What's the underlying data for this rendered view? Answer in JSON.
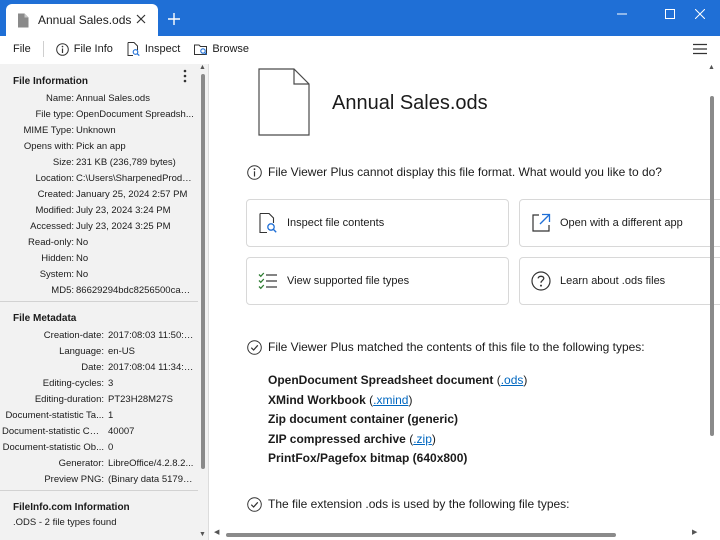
{
  "tab": {
    "title": "Annual Sales.ods"
  },
  "toolbar": {
    "file": "File",
    "file_info": "File Info",
    "inspect": "Inspect",
    "browse": "Browse"
  },
  "sidebar": {
    "file_information": {
      "title": "File Information",
      "rows": [
        {
          "key": "Name:",
          "value": "Annual Sales.ods"
        },
        {
          "key": "File type:",
          "value": "OpenDocument Spreadsh..."
        },
        {
          "key": "MIME Type:",
          "value": "Unknown"
        },
        {
          "key": "Opens with:",
          "value": "Pick an app"
        },
        {
          "key": "Size:",
          "value": "231 KB (236,789 bytes)"
        },
        {
          "key": "Location:",
          "value": "C:\\Users\\SharpenedProdu..."
        },
        {
          "key": "Created:",
          "value": "January 25, 2024 2:57 PM"
        },
        {
          "key": "Modified:",
          "value": "July 23, 2024 3:24 PM"
        },
        {
          "key": "Accessed:",
          "value": "July 23, 2024 3:25 PM"
        },
        {
          "key": "Read-only:",
          "value": "No"
        },
        {
          "key": "Hidden:",
          "value": "No"
        },
        {
          "key": "System:",
          "value": "No"
        },
        {
          "key": "MD5:",
          "value": "86629294bdc8256500ca37..."
        }
      ]
    },
    "file_metadata": {
      "title": "File Metadata",
      "rows": [
        {
          "key": "Creation-date:",
          "value": "2017:08:03 11:50:33"
        },
        {
          "key": "Language:",
          "value": "en-US"
        },
        {
          "key": "Date:",
          "value": "2017:08:04 11:34:04"
        },
        {
          "key": "Editing-cycles:",
          "value": "3"
        },
        {
          "key": "Editing-duration:",
          "value": "PT23H28M27S"
        },
        {
          "key": "Document-statistic Ta...",
          "value": "1"
        },
        {
          "key": "Document-statistic Cel...",
          "value": "40007"
        },
        {
          "key": "Document-statistic Ob...",
          "value": "0"
        },
        {
          "key": "Generator:",
          "value": "LibreOffice/4.2.8.2..."
        },
        {
          "key": "Preview PNG:",
          "value": "(Binary data 51794..."
        }
      ]
    },
    "fileinfo_com": {
      "title": "FileInfo.com Information",
      "text": ".ODS - 2 file types found"
    }
  },
  "main": {
    "file_title": "Annual Sales.ods",
    "info_message": "File Viewer Plus cannot display this file format.  What would you like to do?",
    "actions": [
      {
        "label": "Inspect file contents",
        "icon": "inspect-icon"
      },
      {
        "label": "Open with a different app",
        "icon": "open-external-icon"
      },
      {
        "label": "View supported file types",
        "icon": "checklist-icon"
      },
      {
        "label": "Learn about .ods files",
        "icon": "help-icon"
      }
    ],
    "matched_message": "File Viewer Plus matched the contents of this file to the following types:",
    "matched_types": [
      {
        "name": "OpenDocument Spreadsheet document",
        "pre": " (",
        "link": ".ods",
        "post": ")"
      },
      {
        "name": "XMind Workbook",
        "pre": " (",
        "link": ".xmind",
        "post": ")"
      },
      {
        "name": "Zip document container (generic)",
        "pre": "",
        "link": "",
        "post": ""
      },
      {
        "name": "ZIP compressed archive",
        "pre": " (",
        "link": ".zip",
        "post": ")"
      },
      {
        "name": "PrintFox/Pagefox bitmap (640x800)",
        "pre": "",
        "link": "",
        "post": ""
      }
    ],
    "extension_message": "The file extension .ods is used by the following file types:"
  },
  "colors": {
    "titlebar": "#1f6fd6",
    "link": "#0067c0",
    "sidebar_bg": "#f2f2f2",
    "check": "#2e7d32"
  }
}
